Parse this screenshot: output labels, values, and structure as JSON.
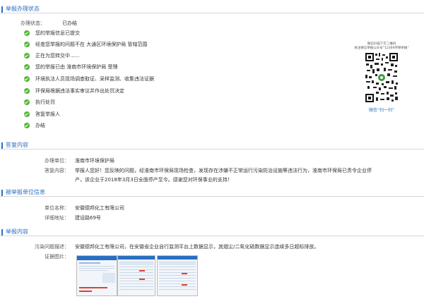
{
  "status": {
    "section_title": "举报办理状态",
    "label": "办理状态：",
    "value": "已办结",
    "steps": [
      "您的举报信息已提交",
      "经查您举报的问题不在 大通区环境保护局 管辖范围",
      "正在为您转交中......",
      "您的举报已由 淮南市环境保护局 受理",
      "环境执法人员现场调查取证、采样监测、收集违法证据",
      "环保局根据违法事实审议并作出处罚决定",
      "执行处罚",
      "答复举报人",
      "办结"
    ],
    "qr_caption_1": "微信扫描下方二维码",
    "qr_caption_2": "关注微信举报公众号“12369环保举报”",
    "qr_scan_label": "微信“扫一扫”",
    "check_color": "#53b534",
    "accent_color": "#2a6fc1"
  },
  "reply": {
    "section_title": "答复内容",
    "unit_label": "办理单位：",
    "unit_value": "淮南市环境保护局",
    "content_label": "答复内容：",
    "content_line_1": "举报人您好！您反映的问题，经淮南市环保局现场检查，发现存在涉嫌不正常运行污染防治设施等违法行为，淮南市环保局已责令企业停",
    "content_line_2": "产，该企业于2018年3月3日全面停产至今。感谢您对环保事业的支持！"
  },
  "reported": {
    "section_title": "被举报单位信息",
    "name_label": "单位名称：",
    "name_value": "安徽德邦化工有限公司",
    "addr_label": "详细地址：",
    "addr_value": "建设路69号"
  },
  "report": {
    "section_title": "举报内容",
    "desc_label": "污染问题描述：",
    "desc_value": "安徽德邦化工有限公司，在安徽省企业自行监测平台上数据显示，其烟尘/二氧化硫数据显示连续多日超标排放。",
    "evidence_label": "证据图片："
  }
}
